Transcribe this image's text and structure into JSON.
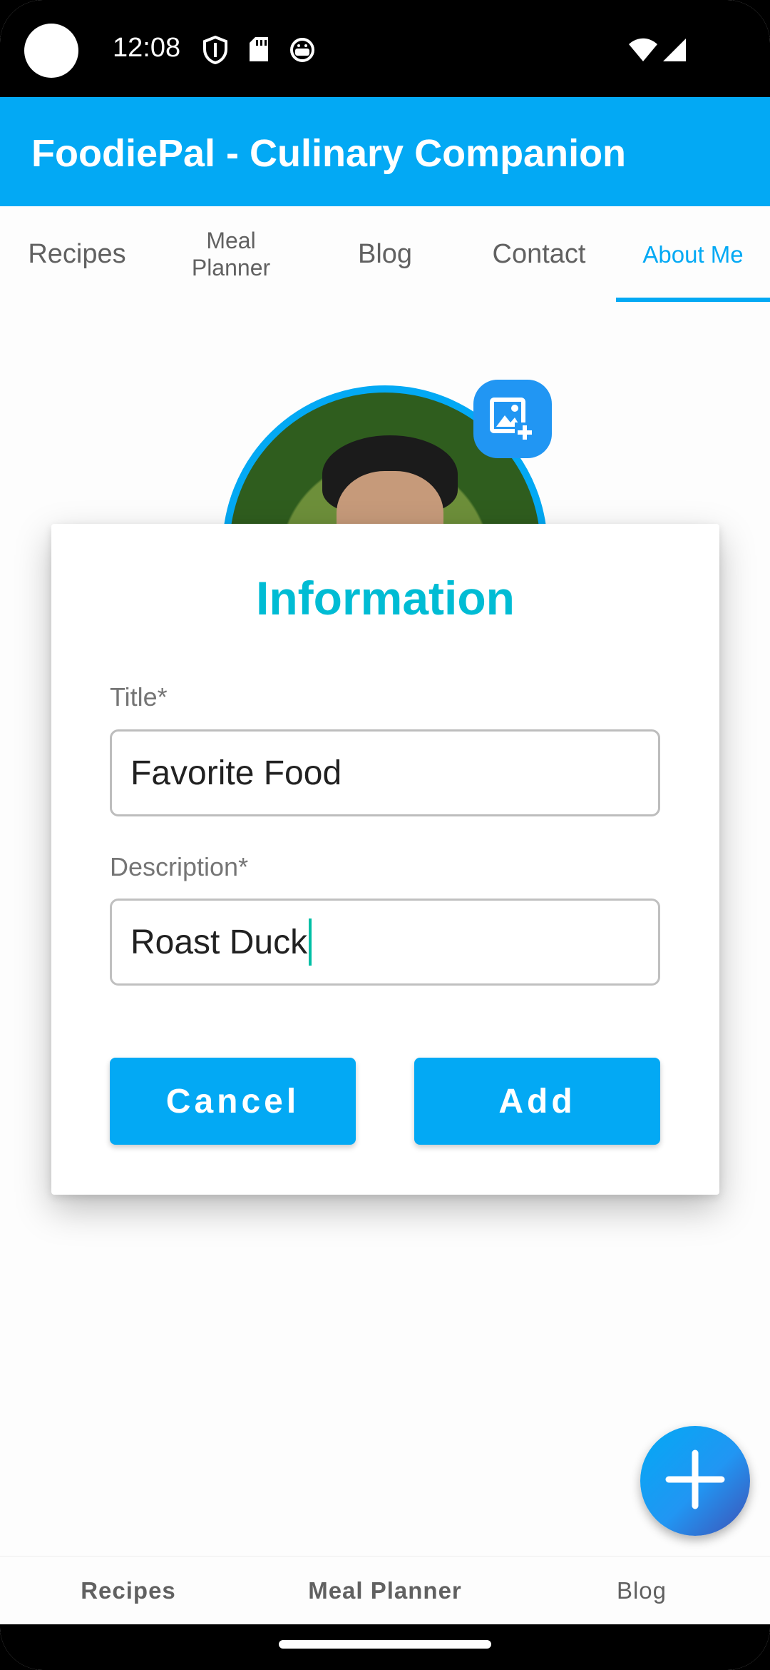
{
  "status_bar": {
    "time": "12:08",
    "icons": [
      "shield-icon",
      "sd-card-icon",
      "android-debug-icon",
      "wifi-icon",
      "signal-icon"
    ]
  },
  "app_bar": {
    "title": "FoodiePal - Culinary Companion",
    "color": "#03a9f4"
  },
  "tabs": [
    {
      "label": "Recipes",
      "active": false
    },
    {
      "label": "Meal Planner",
      "active": false
    },
    {
      "label": "Blog",
      "active": false
    },
    {
      "label": "Contact",
      "active": false
    },
    {
      "label": "About Me",
      "active": true
    }
  ],
  "profile": {
    "avatar": "profile-photo",
    "add_photo_icon": "add-photo-icon"
  },
  "dialog": {
    "title": "Information",
    "title_color": "#00bcd4",
    "title_field": {
      "label": "Title*",
      "value": "Favorite Food"
    },
    "description_field": {
      "label": "Description*",
      "value": "Roast Duck"
    },
    "cancel_label": "Cancel",
    "add_label": "Add"
  },
  "fab": {
    "icon": "plus-icon"
  },
  "bottom_nav": [
    {
      "label": "Recipes",
      "bold": true
    },
    {
      "label": "Meal Planner",
      "bold": true
    },
    {
      "label": "Blog",
      "bold": false
    }
  ]
}
